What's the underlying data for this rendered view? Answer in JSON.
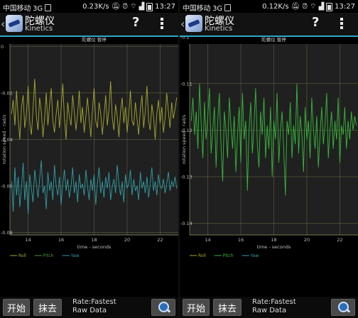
{
  "status_bar": {
    "carrier": "中国移动 3G",
    "time": "13:27",
    "left_panel_speed": "0.23K/s",
    "right_panel_speed": "0.12K/s"
  },
  "app": {
    "title": "陀螺仪",
    "subtitle": "Kinetics",
    "help_label": "?",
    "accent_color": "#29a9c9"
  },
  "bottom_bar": {
    "start_label": "开始",
    "clear_label": "抹去",
    "rate_label": "Rate:Fastest",
    "mode_label": "Raw Data"
  },
  "chart_data": [
    {
      "type": "line",
      "title": "陀螺仪 暂停",
      "xlabel": "time - seconds",
      "ylabel": "rotation speed - rad/s",
      "xlim": [
        12.9,
        23.1
      ],
      "ylim": [
        -0.081,
        0.001
      ],
      "x_ticks": [
        14,
        16,
        18,
        20,
        22
      ],
      "y_ticks": [
        0,
        -0.02,
        -0.04,
        -0.06,
        -0.08
      ],
      "y_tick_labels": [
        "0",
        "-0.02",
        "-0.04",
        "-0.06",
        "-0.08"
      ],
      "grid": true,
      "legend_position": "bottom-left",
      "legend": [
        "Roll",
        "Pitch",
        "Yaw"
      ],
      "series": [
        {
          "name": "Roll",
          "color": "#a6a830",
          "x_start": 13.0,
          "x_step": 0.1,
          "values": [
            -0.029,
            -0.023,
            -0.034,
            -0.019,
            -0.031,
            -0.04,
            -0.026,
            -0.021,
            -0.035,
            -0.029,
            -0.017,
            -0.033,
            -0.038,
            -0.027,
            -0.014,
            -0.03,
            -0.036,
            -0.022,
            -0.028,
            -0.039,
            -0.031,
            -0.02,
            -0.034,
            -0.025,
            -0.018,
            -0.032,
            -0.037,
            -0.029,
            -0.023,
            -0.035,
            -0.027,
            -0.016,
            -0.031,
            -0.04,
            -0.024,
            -0.03,
            -0.034,
            -0.021,
            -0.028,
            -0.036,
            -0.029,
            -0.019,
            -0.033,
            -0.026,
            -0.037,
            -0.03,
            -0.022,
            -0.031,
            -0.039,
            -0.027,
            -0.018,
            -0.032,
            -0.035,
            -0.024,
            -0.029,
            -0.038,
            -0.03,
            -0.021,
            -0.034,
            -0.027,
            -0.015,
            -0.031,
            -0.036,
            -0.025,
            -0.03,
            -0.039,
            -0.028,
            -0.022,
            -0.033,
            -0.026,
            -0.037,
            -0.029,
            -0.019,
            -0.032,
            -0.034,
            -0.024,
            -0.031,
            -0.038,
            -0.027,
            -0.021,
            -0.035,
            -0.028,
            -0.017,
            -0.032,
            -0.036,
            -0.025,
            -0.03,
            -0.04,
            -0.029,
            -0.023,
            -0.033,
            -0.026,
            -0.037,
            -0.031,
            -0.02,
            -0.028,
            -0.035,
            -0.024,
            -0.031,
            -0.027,
            -0.022
          ]
        },
        {
          "name": "Pitch",
          "color": "#4a9a3a",
          "x_start": 13.0,
          "x_step": 0.1,
          "values": []
        },
        {
          "name": "Yaw",
          "color": "#2f9fa7",
          "x_start": 13.0,
          "x_step": 0.1,
          "values": [
            -0.058,
            -0.071,
            -0.052,
            -0.064,
            -0.056,
            -0.069,
            -0.06,
            -0.05,
            -0.066,
            -0.058,
            -0.072,
            -0.055,
            -0.061,
            -0.067,
            -0.053,
            -0.059,
            -0.065,
            -0.057,
            -0.049,
            -0.063,
            -0.06,
            -0.07,
            -0.054,
            -0.062,
            -0.058,
            -0.066,
            -0.051,
            -0.06,
            -0.064,
            -0.056,
            -0.068,
            -0.059,
            -0.053,
            -0.062,
            -0.057,
            -0.065,
            -0.06,
            -0.052,
            -0.063,
            -0.058,
            -0.067,
            -0.055,
            -0.061,
            -0.059,
            -0.064,
            -0.053,
            -0.06,
            -0.066,
            -0.057,
            -0.062,
            -0.055,
            -0.068,
            -0.059,
            -0.052,
            -0.063,
            -0.058,
            -0.065,
            -0.056,
            -0.061,
            -0.054,
            -0.066,
            -0.06,
            -0.057,
            -0.063,
            -0.051,
            -0.059,
            -0.064,
            -0.058,
            -0.067,
            -0.055,
            -0.061,
            -0.059,
            -0.053,
            -0.064,
            -0.057,
            -0.062,
            -0.06,
            -0.066,
            -0.054,
            -0.061,
            -0.058,
            -0.063,
            -0.056,
            -0.065,
            -0.059,
            -0.052,
            -0.062,
            -0.058,
            -0.064,
            -0.055,
            -0.06,
            -0.061,
            -0.057,
            -0.063,
            -0.059,
            -0.054,
            -0.062,
            -0.058,
            -0.06,
            -0.056,
            -0.061
          ]
        }
      ]
    },
    {
      "type": "line",
      "title": "陀螺仪 暂停",
      "xlabel": "time - seconds",
      "ylabel": "rotation speed - rad/s",
      "xlim": [
        12.9,
        23.1
      ],
      "ylim": [
        -0.1425,
        -0.1015
      ],
      "x_ticks": [
        14,
        16,
        18,
        20,
        22
      ],
      "y_ticks": [
        -0.1,
        -0.11,
        -0.12,
        -0.13,
        -0.14
      ],
      "y_tick_labels": [
        "-0.1",
        "-0.11",
        "-0.12",
        "-0.13",
        "-0.14"
      ],
      "grid": true,
      "legend_position": "bottom-left",
      "legend": [
        "Roll",
        "Pitch",
        "Yaw"
      ],
      "series": [
        {
          "name": "Roll",
          "color": "#a6a830",
          "x_start": 13.0,
          "x_step": 0.1,
          "values": []
        },
        {
          "name": "Pitch",
          "color": "#36b93a",
          "x_start": 13.0,
          "x_step": 0.1,
          "values": [
            -0.118,
            -0.113,
            -0.121,
            -0.116,
            -0.124,
            -0.11,
            -0.119,
            -0.126,
            -0.114,
            -0.122,
            -0.117,
            -0.111,
            -0.125,
            -0.12,
            -0.115,
            -0.128,
            -0.118,
            -0.112,
            -0.123,
            -0.131,
            -0.116,
            -0.12,
            -0.126,
            -0.113,
            -0.119,
            -0.124,
            -0.117,
            -0.129,
            -0.121,
            -0.115,
            -0.127,
            -0.112,
            -0.122,
            -0.118,
            -0.133,
            -0.12,
            -0.114,
            -0.125,
            -0.119,
            -0.111,
            -0.123,
            -0.128,
            -0.116,
            -0.121,
            -0.113,
            -0.126,
            -0.119,
            -0.124,
            -0.115,
            -0.13,
            -0.118,
            -0.122,
            -0.112,
            -0.127,
            -0.12,
            -0.116,
            -0.124,
            -0.134,
            -0.118,
            -0.121,
            -0.114,
            -0.126,
            -0.119,
            -0.123,
            -0.11,
            -0.125,
            -0.117,
            -0.121,
            -0.129,
            -0.115,
            -0.122,
            -0.118,
            -0.126,
            -0.113,
            -0.12,
            -0.124,
            -0.117,
            -0.128,
            -0.121,
            -0.115,
            -0.123,
            -0.119,
            -0.112,
            -0.126,
            -0.12,
            -0.116,
            -0.124,
            -0.118,
            -0.122,
            -0.113,
            -0.127,
            -0.119,
            -0.121,
            -0.115,
            -0.124,
            -0.118,
            -0.122,
            -0.116,
            -0.12,
            -0.117,
            -0.119
          ]
        },
        {
          "name": "Yaw",
          "color": "#2f9fa7",
          "x_start": 13.0,
          "x_step": 0.1,
          "values": []
        }
      ]
    }
  ]
}
